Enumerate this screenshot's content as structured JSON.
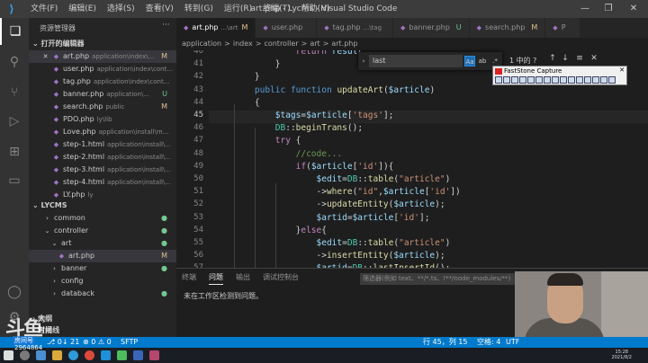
{
  "menu": [
    "文件(F)",
    "编辑(E)",
    "选择(S)",
    "查看(V)",
    "转到(G)",
    "运行(R)",
    "终端(T)",
    "帮助(H)"
  ],
  "window_title": "art.php - Lycms - Visual Studio Code",
  "sidebar": {
    "title": "资源管理器",
    "more": "···",
    "open_editors_label": "打开的编辑器",
    "open_editors": [
      {
        "name": "art.php",
        "path": "application\\index\\...",
        "status": "M",
        "close": "✕"
      },
      {
        "name": "user.php",
        "path": "application\\index\\cont...",
        "status": ""
      },
      {
        "name": "tag.php",
        "path": "application\\index\\cont...",
        "status": ""
      },
      {
        "name": "banner.php",
        "path": "application\\...",
        "status": "U"
      },
      {
        "name": "search.php",
        "path": "public",
        "status": "M"
      },
      {
        "name": "PDO.php",
        "path": "ly\\lib",
        "status": ""
      },
      {
        "name": "Love.php",
        "path": "application\\install\\m...",
        "status": ""
      },
      {
        "name": "step-1.html",
        "path": "application\\install\\...",
        "status": ""
      },
      {
        "name": "step-2.html",
        "path": "application\\install\\...",
        "status": ""
      },
      {
        "name": "step-3.html",
        "path": "application\\install\\...",
        "status": ""
      },
      {
        "name": "step-4.html",
        "path": "application\\install\\...",
        "status": ""
      },
      {
        "name": "LY.php",
        "path": "ly",
        "status": ""
      }
    ],
    "workspace_label": "LYCMS",
    "tree": [
      {
        "name": "common",
        "indent": 1,
        "type": "folder",
        "marker": "●"
      },
      {
        "name": "controller",
        "indent": 1,
        "type": "folder-open",
        "marker": "●"
      },
      {
        "name": "art",
        "indent": 2,
        "type": "folder-open",
        "marker": "●"
      },
      {
        "name": "art.php",
        "indent": 3,
        "type": "file",
        "marker": "M"
      },
      {
        "name": "banner",
        "indent": 2,
        "type": "folder",
        "marker": "●"
      },
      {
        "name": "config",
        "indent": 2,
        "type": "folder",
        "marker": ""
      },
      {
        "name": "databack",
        "indent": 2,
        "type": "folder",
        "marker": "●"
      }
    ],
    "outline_label": "大纲",
    "timeline_label": "时间线"
  },
  "tabs": [
    {
      "name": "art.php",
      "extra": "...\\art",
      "status": "M",
      "active": true
    },
    {
      "name": "user.php",
      "extra": "",
      "status": "",
      "active": false
    },
    {
      "name": "tag.php",
      "extra": "...\\tag",
      "status": "",
      "active": false
    },
    {
      "name": "banner.php",
      "extra": "",
      "status": "U",
      "active": false
    },
    {
      "name": "search.php",
      "extra": "",
      "status": "M",
      "active": false
    },
    {
      "name": "P",
      "extra": "",
      "status": "",
      "active": false
    }
  ],
  "breadcrumb": [
    "application",
    ">",
    "index",
    ">",
    "controller",
    ">",
    "art",
    ">",
    "art.php"
  ],
  "editor": {
    "lines": [
      {
        "n": "40",
        "html": "            <span class=\"ctl\">return</span> <span class=\"var\">result</span>..."
      },
      {
        "n": "41",
        "html": "        }"
      },
      {
        "n": "42",
        "html": "    }"
      },
      {
        "n": "43",
        "html": "    <span class=\"kw\">public</span> <span class=\"kw\">function</span> <span class=\"fn\">updateArt</span>(<span class=\"var\">$article</span>)"
      },
      {
        "n": "44",
        "html": "    {"
      },
      {
        "n": "45",
        "html": "        <span class=\"var\">$tags</span>=<span class=\"var\">$article</span>[<span class=\"str\">'tags'</span>];"
      },
      {
        "n": "46",
        "html": "        <span class=\"cls\">DB</span>::<span class=\"fn\">beginTrans</span>();"
      },
      {
        "n": "47",
        "html": "        <span class=\"ctl\">try</span> {"
      },
      {
        "n": "48",
        "html": "            <span class=\"cm\">//code...</span>"
      },
      {
        "n": "49",
        "html": "            <span class=\"ctl\">if</span>(<span class=\"var\">$article</span>[<span class=\"str\">'id'</span>]){"
      },
      {
        "n": "50",
        "html": "                <span class=\"var\">$edit</span>=<span class=\"cls\">DB</span>::<span class=\"fn\">table</span>(<span class=\"str\">\"article\"</span>)"
      },
      {
        "n": "51",
        "html": "                -><span class=\"fn\">where</span>(<span class=\"str\">\"id\"</span>,<span class=\"var\">$article</span>[<span class=\"str\">'id'</span>])"
      },
      {
        "n": "52",
        "html": "                -><span class=\"fn\">updateEntity</span>(<span class=\"var\">$article</span>);"
      },
      {
        "n": "53",
        "html": "                <span class=\"var\">$artid</span>=<span class=\"var\">$article</span>[<span class=\"str\">'id'</span>];"
      },
      {
        "n": "54",
        "html": "            }<span class=\"ctl\">else</span>{"
      },
      {
        "n": "55",
        "html": "                <span class=\"var\">$edit</span>=<span class=\"cls\">DB</span>::<span class=\"fn\">table</span>(<span class=\"str\">\"article\"</span>)"
      },
      {
        "n": "56",
        "html": "                -><span class=\"fn\">insertEntity</span>(<span class=\"var\">$article</span>);"
      },
      {
        "n": "57",
        "html": "                <span class=\"var\">$artid</span>=<span class=\"cls\">DB</span>::<span class=\"fn\">lastInsertId</span>();"
      }
    ],
    "current_line": "45"
  },
  "find": {
    "value": "last",
    "opt_case": "Aa",
    "opt_word": "ab",
    "opt_regex": ".*",
    "result": "1 中的 ?",
    "prev": "↑",
    "next": "↓",
    "sel": "≡",
    "close": "✕"
  },
  "faststone": {
    "title": "FastStone Capture",
    "close": "✕"
  },
  "panel": {
    "tabs": [
      "终端",
      "问题",
      "输出",
      "调试控制台"
    ],
    "active_tab": "问题",
    "filter_placeholder": "筛选器(例如 text、**/*.ts、!**/node_modules/**)",
    "message": "未在工作区检测到问题。"
  },
  "statusbar": {
    "branch": "⎇ 0↓ 21",
    "problems": "⊗ 0 ⚠ 0",
    "sftp": "SFTP",
    "position": "行 45，列 15",
    "spaces": "空格: 4",
    "encoding": "UTF"
  },
  "watermark": {
    "logo": "斗鱼",
    "suffix1": "网",
    "suffix2": "直播",
    "room_label": "房间号",
    "room_id": "2964864"
  },
  "clock": {
    "time": "15:28",
    "date": "2021/8/2"
  },
  "colors": {
    "accent": "#007acc",
    "modified": "#e2c08d",
    "untracked": "#73c991"
  }
}
